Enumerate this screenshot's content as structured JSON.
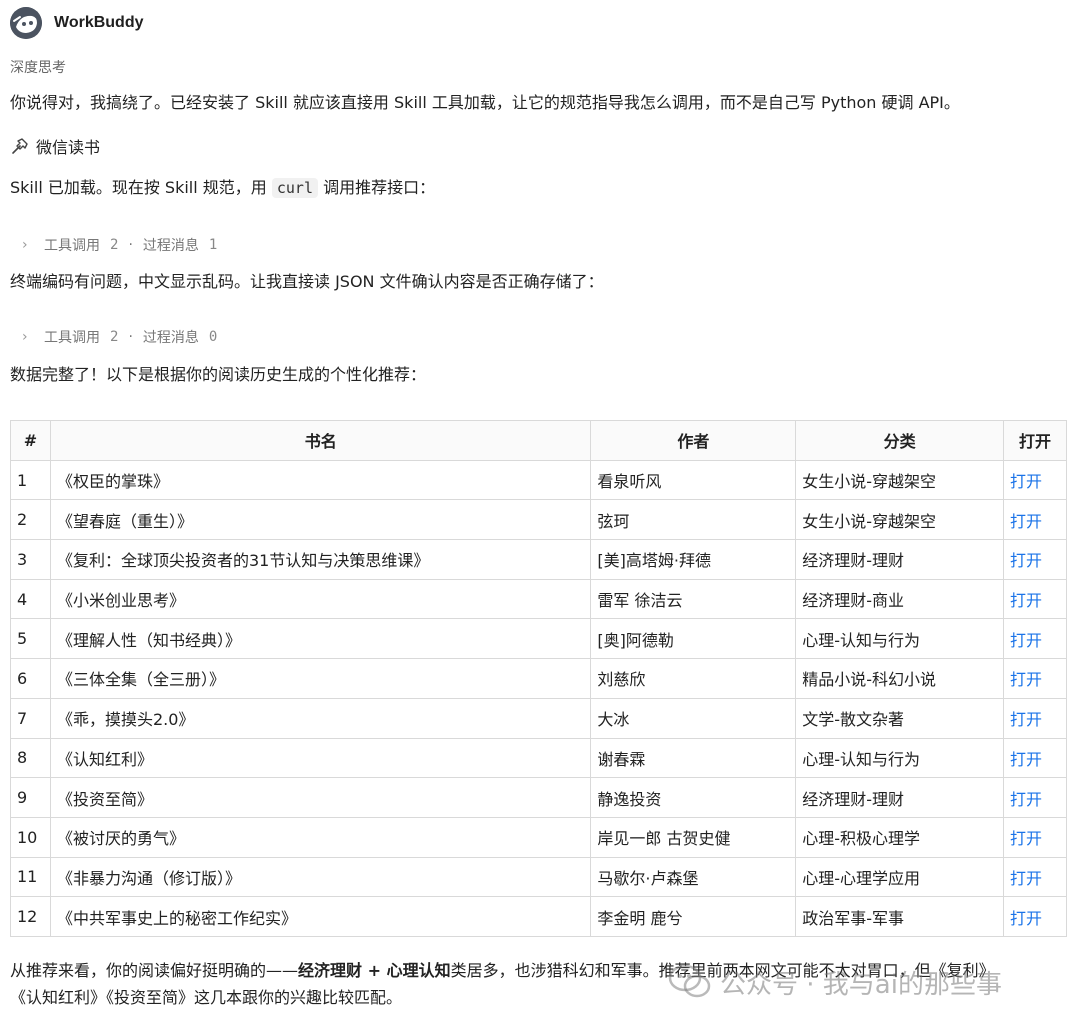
{
  "header": {
    "app_name": "WorkBuddy"
  },
  "thinking_label": "深度思考",
  "messages": {
    "p1": "你说得对，我搞绕了。已经安装了 Skill 就应该直接用 Skill 工具加载，让它的规范指导我怎么调用，而不是自己写 Python 硬调 API。",
    "skill_name": "微信读书",
    "p2_before": "Skill 已加载。现在按 Skill 规范，用 ",
    "p2_code": "curl",
    "p2_after": " 调用推荐接口：",
    "tool1": {
      "calls_label": "工具调用",
      "calls_count": "2",
      "sep": "·",
      "msgs_label": "过程消息",
      "msgs_count": "1"
    },
    "p3": "终端编码有问题，中文显示乱码。让我直接读 JSON 文件确认内容是否正确存储了：",
    "tool2": {
      "calls_label": "工具调用",
      "calls_count": "2",
      "sep": "·",
      "msgs_label": "过程消息",
      "msgs_count": "0"
    },
    "p4": "数据完整了！以下是根据你的阅读历史生成的个性化推荐："
  },
  "table": {
    "headers": [
      "#",
      "书名",
      "作者",
      "分类",
      "打开"
    ],
    "rows": [
      [
        "1",
        "《权臣的掌珠》",
        "看泉听风",
        "女生小说-穿越架空",
        "打开"
      ],
      [
        "2",
        "《望春庭（重生）》",
        "弦珂",
        "女生小说-穿越架空",
        "打开"
      ],
      [
        "3",
        "《复利：全球顶尖投资者的31节认知与决策思维课》",
        "[美]高塔姆·拜德",
        "经济理财-理财",
        "打开"
      ],
      [
        "4",
        "《小米创业思考》",
        "雷军 徐洁云",
        "经济理财-商业",
        "打开"
      ],
      [
        "5",
        "《理解人性（知书经典）》",
        "[奥]阿德勒",
        "心理-认知与行为",
        "打开"
      ],
      [
        "6",
        "《三体全集（全三册）》",
        "刘慈欣",
        "精品小说-科幻小说",
        "打开"
      ],
      [
        "7",
        "《乖，摸摸头2.0》",
        "大冰",
        "文学-散文杂著",
        "打开"
      ],
      [
        "8",
        "《认知红利》",
        "谢春霖",
        "心理-认知与行为",
        "打开"
      ],
      [
        "9",
        "《投资至简》",
        "静逸投资",
        "经济理财-理财",
        "打开"
      ],
      [
        "10",
        "《被讨厌的勇气》",
        "岸见一郎 古贺史健",
        "心理-积极心理学",
        "打开"
      ],
      [
        "11",
        "《非暴力沟通（修订版）》",
        "马歇尔·卢森堡",
        "心理-心理学应用",
        "打开"
      ],
      [
        "12",
        "《中共军事史上的秘密工作纪实》",
        "李金明 鹿兮",
        "政治军事-军事",
        "打开"
      ]
    ]
  },
  "summary": {
    "part1": "从推荐来看，你的阅读偏好挺明确的——",
    "bold": "经济理财 + 心理认知",
    "part2": "类居多，也涉猎科幻和军事。推荐里前两本网文可能不太对胃口，但《复利》",
    "line2": "《认知红利》《投资至简》这几本跟你的兴趣比较匹配。"
  },
  "watermark": {
    "text": "公众号 · 我与ai的那些事"
  },
  "colors": {
    "link": "#1a73e8",
    "border": "#d9d9d9",
    "muted": "#777777"
  }
}
